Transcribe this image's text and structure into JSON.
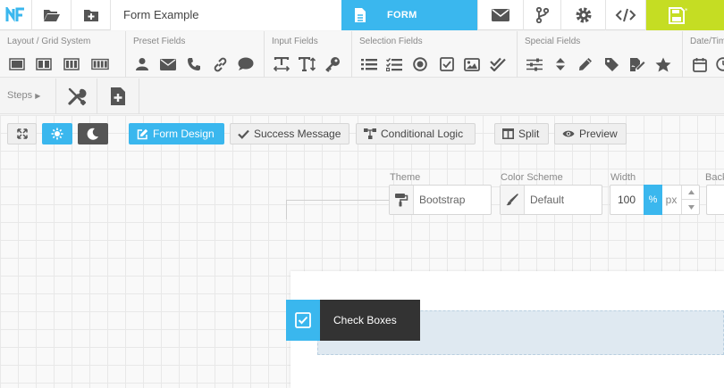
{
  "topbar": {
    "form_name": "Form Example",
    "form_tab_label": "FORM"
  },
  "toolbar": {
    "groups": [
      {
        "title": "Layout / Grid System"
      },
      {
        "title": "Preset Fields"
      },
      {
        "title": "Input Fields"
      },
      {
        "title": "Selection Fields"
      },
      {
        "title": "Special Fields"
      },
      {
        "title": "Date/Tim"
      }
    ]
  },
  "steps": {
    "label": "Steps"
  },
  "view_buttons": {
    "form_design": "Form Design",
    "success_message": "Success Message",
    "conditional_logic": "Conditional Logic",
    "split": "Split",
    "preview": "Preview"
  },
  "theme": {
    "theme_label": "Theme",
    "theme_value": "Bootstrap",
    "scheme_label": "Color Scheme",
    "scheme_value": "Default",
    "width_label": "Width",
    "width_value": "100",
    "unit_percent": "%",
    "unit_px": "px",
    "background_label": "Back"
  },
  "canvas": {
    "field_chip_label": "Check Boxes"
  },
  "colors": {
    "accent": "#3ab7ee",
    "save": "#c5dd23",
    "dark": "#333333"
  }
}
